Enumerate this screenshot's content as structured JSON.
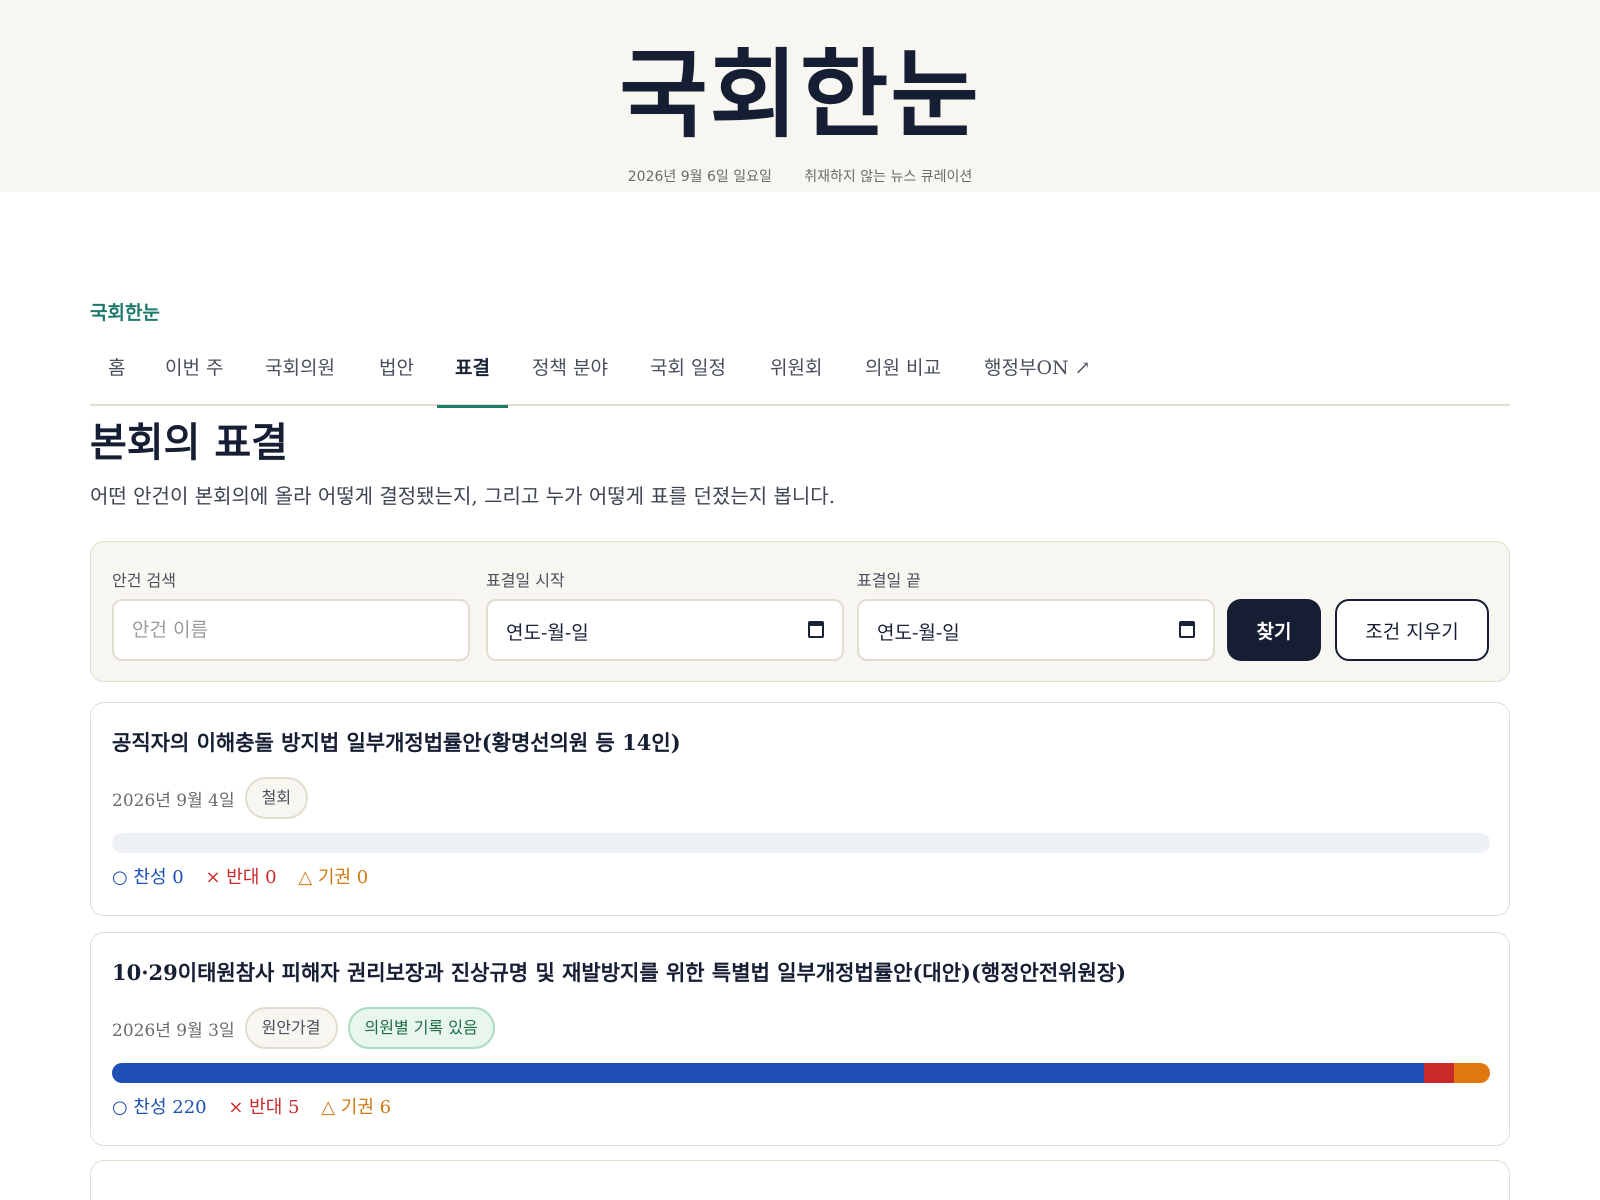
{
  "masthead": {
    "title": "국회한눈",
    "date": "2026년 9월 6일 일요일",
    "tagline": "취재하지 않는 뉴스 큐레이션"
  },
  "brand": "국회한눈",
  "nav": {
    "items": [
      {
        "label": "홈"
      },
      {
        "label": "이번 주"
      },
      {
        "label": "국회의원"
      },
      {
        "label": "법안"
      },
      {
        "label": "표결"
      },
      {
        "label": "정책 분야"
      },
      {
        "label": "국회 일정"
      },
      {
        "label": "위원회"
      },
      {
        "label": "의원 비교"
      },
      {
        "label": "행정부ON ↗"
      }
    ],
    "active": "표결"
  },
  "page": {
    "title": "본회의 표결",
    "description": "어떤 안건이 본회의에 올라 어떻게 결정됐는지, 그리고 누가 어떻게 표를 던졌는지 봅니다."
  },
  "filter": {
    "search_label": "안건 검색",
    "search_placeholder": "안건 이름",
    "start_label": "표결일 시작",
    "start_value": "연도-월-일",
    "end_label": "표결일 끝",
    "end_value": "연도-월-일",
    "find_label": "찾기",
    "clear_label": "조건 지우기"
  },
  "votes": [
    {
      "title": "공직자의 이해충돌 방지법 일부개정법률안(황명선의원 등 14인)",
      "date": "2026년 9월 4일",
      "result": "철회",
      "record_tag": "",
      "yes": 0,
      "no": 0,
      "abstain": 0,
      "yes_text": "○ 찬성 0",
      "no_text": "× 반대 0",
      "abstain_text": "△ 기권 0"
    },
    {
      "title": "10·29이태원참사 피해자 권리보장과 진상규명 및 재발방지를 위한 특별법 일부개정법률안(대안)(행정안전위원장)",
      "date": "2026년 9월 3일",
      "result": "원안가결",
      "record_tag": "의원별 기록 있음",
      "yes": 220,
      "no": 5,
      "abstain": 6,
      "yes_text": "○ 찬성 220",
      "no_text": "× 반대 5",
      "abstain_text": "△ 기권 6"
    }
  ],
  "colors": {
    "accent": "#1f7a6e",
    "navy": "#161e33",
    "yes": "#1d4fb5",
    "no": "#cc2a2a",
    "abstain": "#e0770f"
  }
}
